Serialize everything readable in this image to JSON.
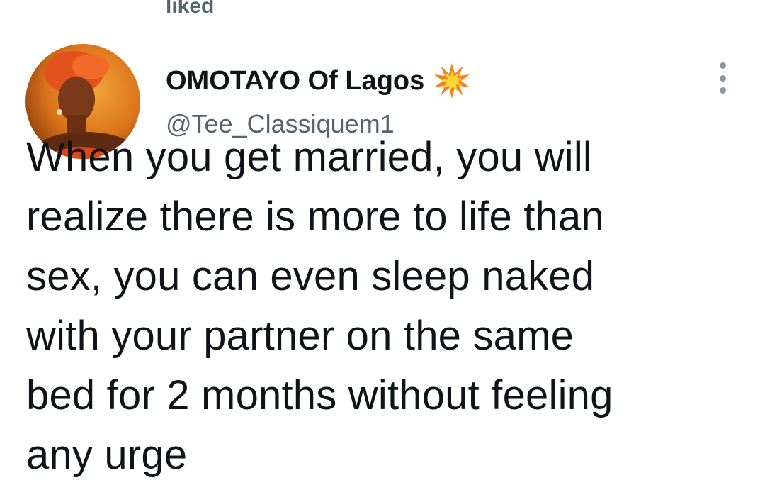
{
  "social_context": "liked",
  "author": {
    "display_name": "OMOTAYO Of Lagos",
    "badge_icon": "collision-emoji-icon",
    "handle": "@Tee_Classiquem1"
  },
  "tweet": {
    "text": "When you get married, you will\nrealize there is more to life than\nsex, you can even sleep naked\nwith your partner on the same\nbed for 2 months without feeling\nany urge"
  },
  "menu": {
    "icon": "more-vertical-icon"
  },
  "colors": {
    "text_primary": "#0f1419",
    "text_secondary": "#536471",
    "icon_gray": "#8b98a5"
  }
}
